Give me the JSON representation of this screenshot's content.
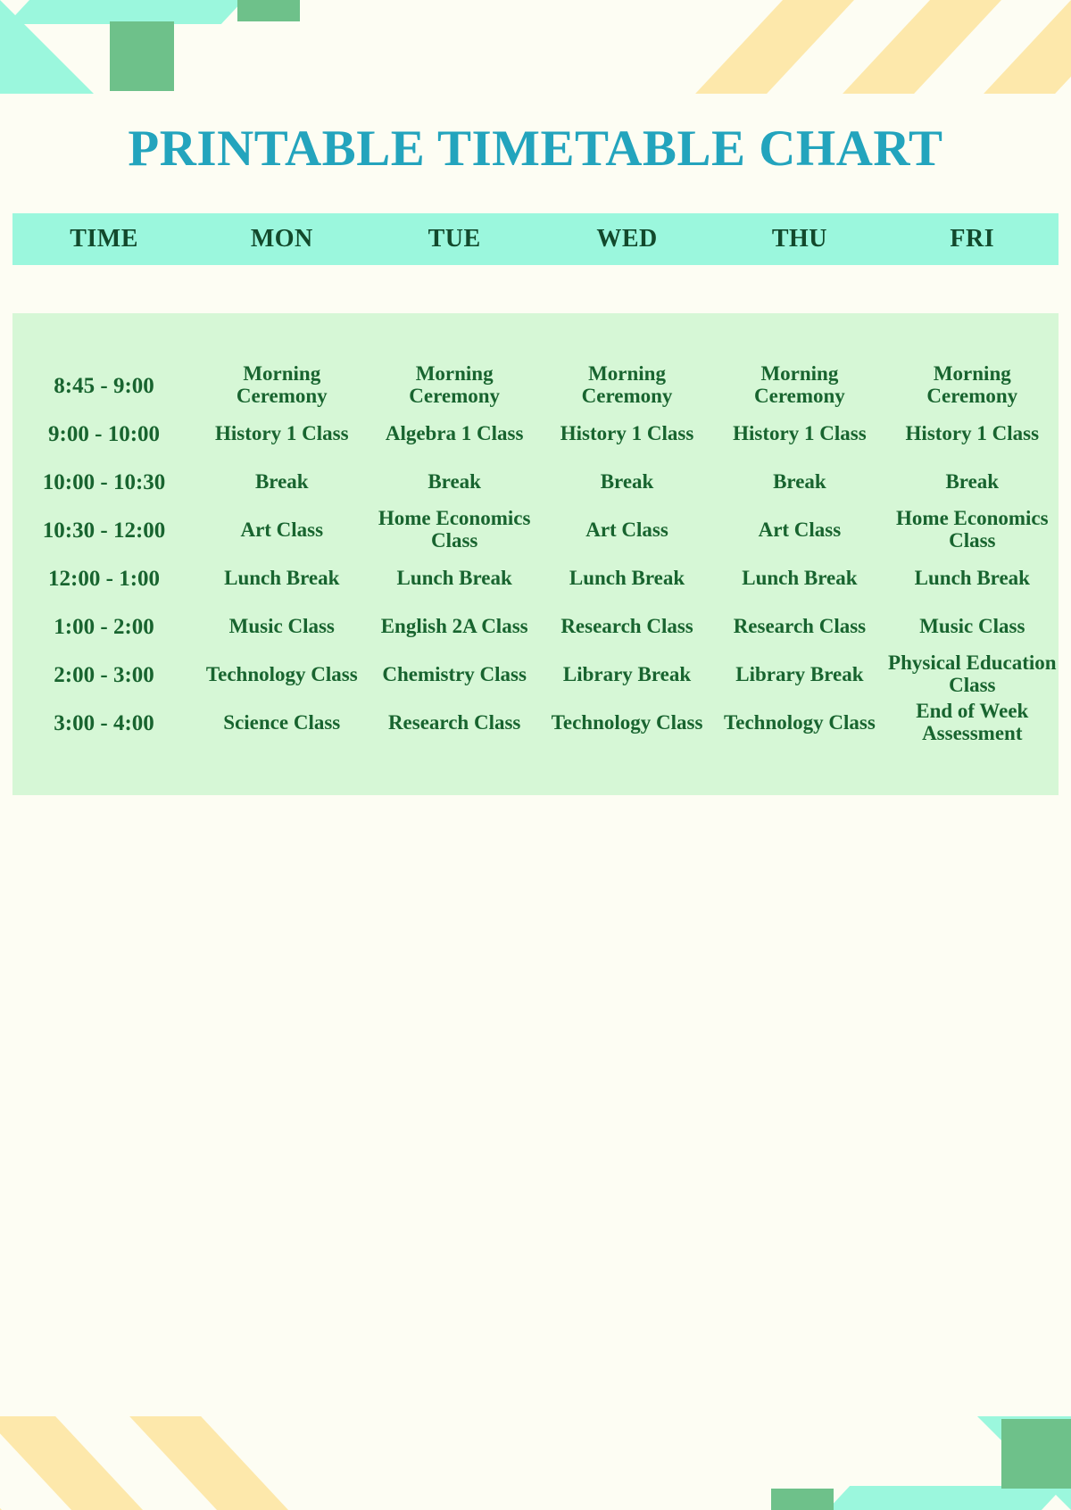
{
  "title": "PRINTABLE TIMETABLE CHART",
  "colors": {
    "page_background": "#fdfdf3",
    "title": "#23a4bd",
    "header_row": "#9bf7dd",
    "body_background": "#d6f7d6",
    "text": "#18642f",
    "header_text": "#12492c",
    "accent_green": "#6ec18a",
    "accent_yellow": "#fde8ab",
    "accent_mint": "#9bf7dd"
  },
  "table": {
    "columns": [
      "TIME",
      "MON",
      "TUE",
      "WED",
      "THU",
      "FRI"
    ],
    "rows": [
      {
        "time": "8:45 - 9:00",
        "mon": "Morning Ceremony",
        "tue": "Morning Ceremony",
        "wed": "Morning Ceremony",
        "thu": "Morning Ceremony",
        "fri": "Morning Ceremony"
      },
      {
        "time": "9:00 - 10:00",
        "mon": "History 1 Class",
        "tue": "Algebra 1 Class",
        "wed": "History 1 Class",
        "thu": "History 1 Class",
        "fri": "History 1 Class"
      },
      {
        "time": "10:00 - 10:30",
        "mon": "Break",
        "tue": "Break",
        "wed": "Break",
        "thu": "Break",
        "fri": "Break"
      },
      {
        "time": "10:30 - 12:00",
        "mon": "Art Class",
        "tue": "Home Economics Class",
        "wed": "Art Class",
        "thu": "Art Class",
        "fri": "Home Economics Class"
      },
      {
        "time": "12:00 - 1:00",
        "mon": "Lunch Break",
        "tue": "Lunch Break",
        "wed": "Lunch Break",
        "thu": "Lunch Break",
        "fri": "Lunch Break"
      },
      {
        "time": "1:00 - 2:00",
        "mon": "Music Class",
        "tue": "English 2A Class",
        "wed": "Research Class",
        "thu": "Research Class",
        "fri": "Music Class"
      },
      {
        "time": "2:00 - 3:00",
        "mon": "Technology Class",
        "tue": "Chemistry Class",
        "wed": "Library Break",
        "thu": "Library Break",
        "fri": "Physical Education Class"
      },
      {
        "time": "3:00 - 4:00",
        "mon": "Science Class",
        "tue": "Research Class",
        "wed": "Technology Class",
        "thu": "Technology Class",
        "fri": "End of Week Assessment"
      }
    ]
  }
}
